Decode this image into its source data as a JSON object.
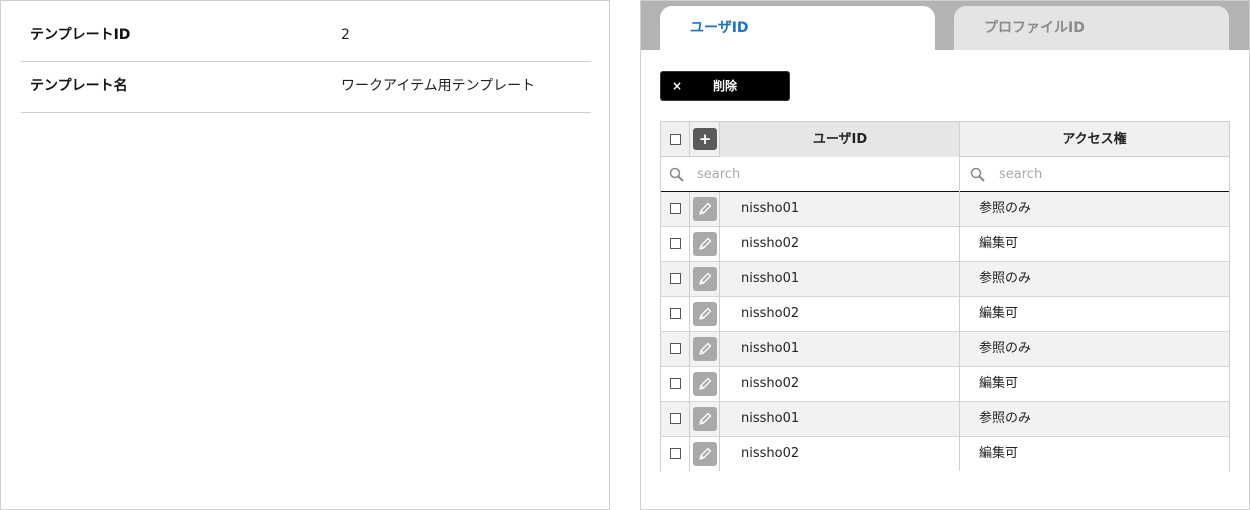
{
  "template_info": {
    "rows": [
      {
        "label": "テンプレートID",
        "value": "2"
      },
      {
        "label": "テンプレート名",
        "value": "ワークアイテム用テンプレート"
      }
    ]
  },
  "tabs": [
    {
      "label": "ユーザID",
      "active": true
    },
    {
      "label": "プロファイルID",
      "active": false
    }
  ],
  "toolbar": {
    "delete_icon": "×",
    "delete_label": "削除"
  },
  "table": {
    "add_icon": "+",
    "columns": [
      "ユーザID",
      "アクセス権"
    ],
    "search_placeholders": [
      "search",
      "search"
    ],
    "rows": [
      {
        "user_id": "nissho01",
        "access": "参照のみ"
      },
      {
        "user_id": "nissho02",
        "access": "編集可"
      },
      {
        "user_id": "nissho01",
        "access": "参照のみ"
      },
      {
        "user_id": "nissho02",
        "access": "編集可"
      },
      {
        "user_id": "nissho01",
        "access": "参照のみ"
      },
      {
        "user_id": "nissho02",
        "access": "編集可"
      },
      {
        "user_id": "nissho01",
        "access": "参照のみ"
      },
      {
        "user_id": "nissho02",
        "access": "編集可"
      }
    ]
  },
  "colors": {
    "active_tab_text": "#1a73c7",
    "tab_bar_bg": "#b3b3b3",
    "delete_button_bg": "#000000",
    "odd_row_bg": "#f2f2f2"
  }
}
